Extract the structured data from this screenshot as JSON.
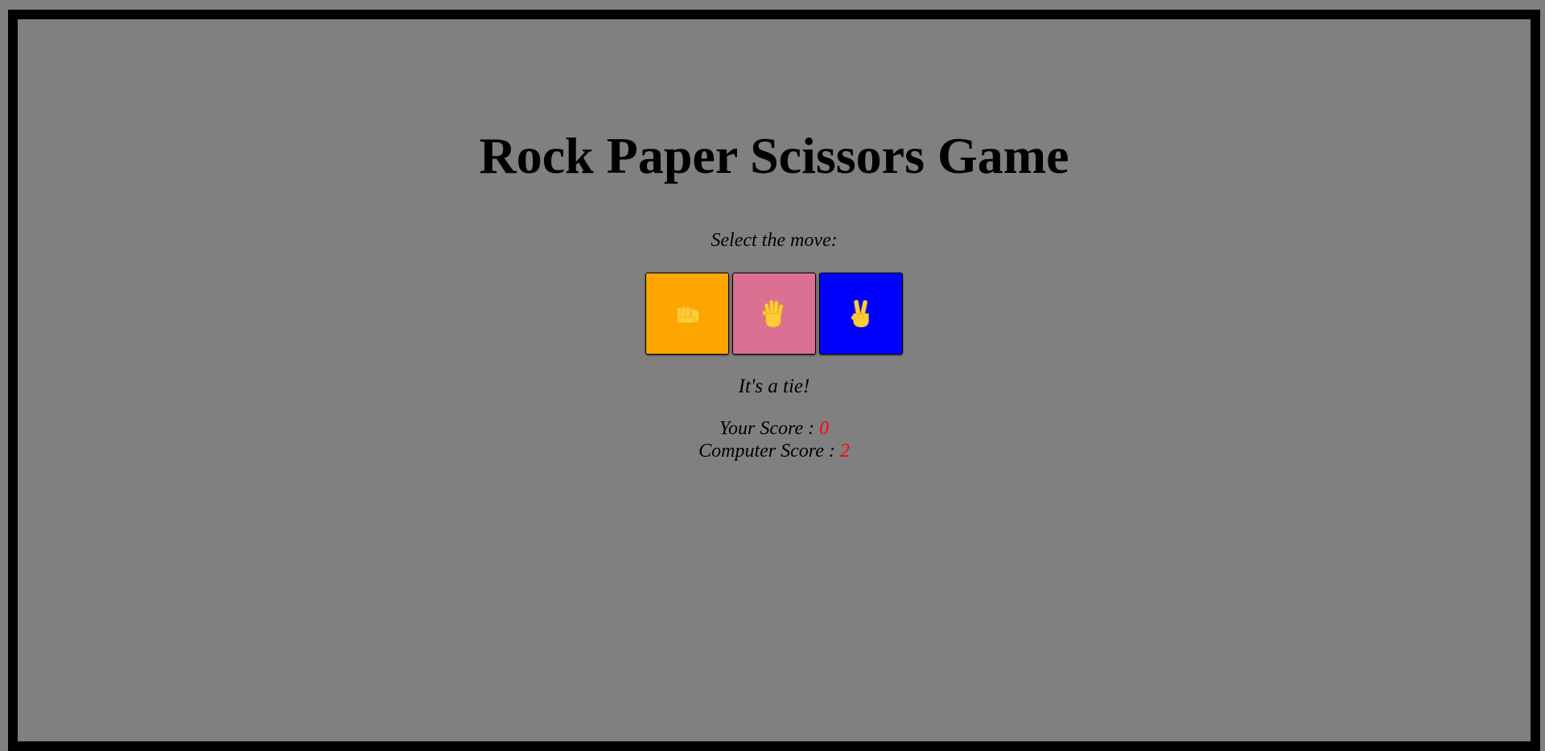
{
  "title": "Rock Paper Scissors Game",
  "prompt": "Select the move:",
  "moves": [
    {
      "label": "rock",
      "icon": "fist-icon",
      "color": "#ffa500"
    },
    {
      "label": "paper",
      "icon": "raised-hand-icon",
      "color": "#db7093"
    },
    {
      "label": "scissors",
      "icon": "victory-hand-icon",
      "color": "#0000ff"
    }
  ],
  "result": "It's a tie!",
  "scores": {
    "player_label": "Your Score : ",
    "player_value": "0",
    "computer_label": "Computer Score : ",
    "computer_value": "2"
  },
  "colors": {
    "page_background": "#808080",
    "frame_border": "#000000",
    "score_value": "#ff0000",
    "emoji_yellow": "#ffcc33"
  }
}
